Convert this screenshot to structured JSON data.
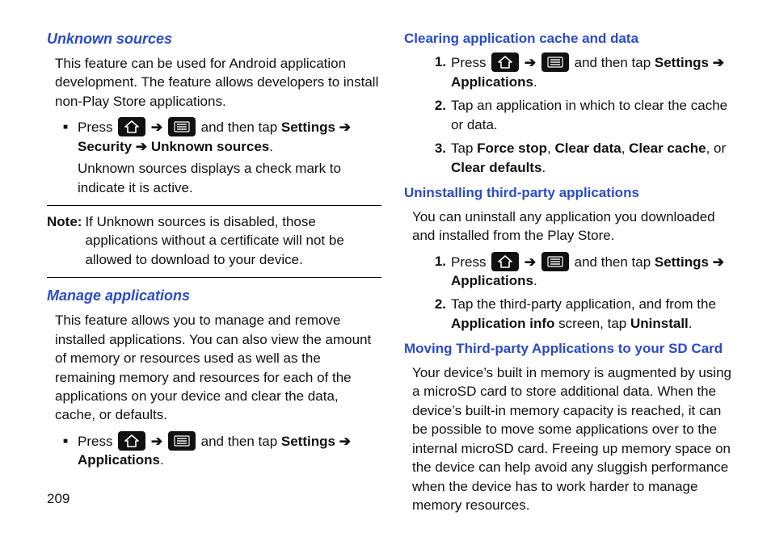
{
  "page_number": "209",
  "icons": {
    "home": "home-icon",
    "menu": "menu-icon"
  },
  "arrow": "➔",
  "left": {
    "unknown": {
      "heading": "Unknown sources",
      "intro": "This feature can be used for Android application development. The feature allows developers to install non-Play Store applications.",
      "press": "Press ",
      "tap_lead": " and then tap ",
      "path1": "Settings",
      "path2": "Security",
      "path3": "Unknown sources",
      "period": ".",
      "after": "Unknown sources displays a check mark to indicate it is active.",
      "note_label": "Note:",
      "note_body": "If Unknown sources is disabled, those applications without a certificate will not be allowed to download to your device."
    },
    "manage": {
      "heading": "Manage applications",
      "intro": "This feature allows you to manage and remove installed applications. You can also view the amount of memory or resources used as well as the remaining memory and resources for each of the applications on your device and clear the data, cache, or defaults.",
      "press": "Press ",
      "tap_lead": " and then tap ",
      "path1": "Settings",
      "path2": "Applications",
      "period": "."
    }
  },
  "right": {
    "clearing": {
      "heading": "Clearing application cache and data",
      "step1_press": "Press ",
      "step1_tap_lead": " and then tap ",
      "step1_path1": "Settings",
      "step1_path2": "Applications",
      "step1_period": ".",
      "n1": "1.",
      "step2": "Tap an application in which to clear the cache or data.",
      "n2": "2.",
      "step3_lead": "Tap ",
      "step3_a": "Force stop",
      "step3_b": "Clear data",
      "step3_c": "Clear cache",
      "step3_or": ", or ",
      "step3_d": "Clear defaults",
      "step3_end": ".",
      "sep": ", ",
      "n3": "3."
    },
    "uninstall": {
      "heading": "Uninstalling third-party applications",
      "intro": "You can uninstall any application you downloaded and installed from the Play Store.",
      "n1": "1.",
      "step1_press": "Press ",
      "step1_tap_lead": " and then tap ",
      "step1_path1": "Settings",
      "step1_path2": "Applications",
      "step1_period": ".",
      "n2": "2.",
      "step2_a": "Tap the third-party application, and from the ",
      "step2_b": "Application info",
      "step2_c": " screen, tap ",
      "step2_d": "Uninstall",
      "step2_e": "."
    },
    "moving": {
      "heading": "Moving Third-party Applications to your SD Card",
      "body": "Your device’s built in memory is augmented by using a microSD card to store additional data. When the device’s built-in memory capacity is reached, it can be possible to move some applications over to the internal microSD card. Freeing up memory space on the device can help avoid any sluggish performance when the device has to work harder to manage memory resources."
    }
  }
}
